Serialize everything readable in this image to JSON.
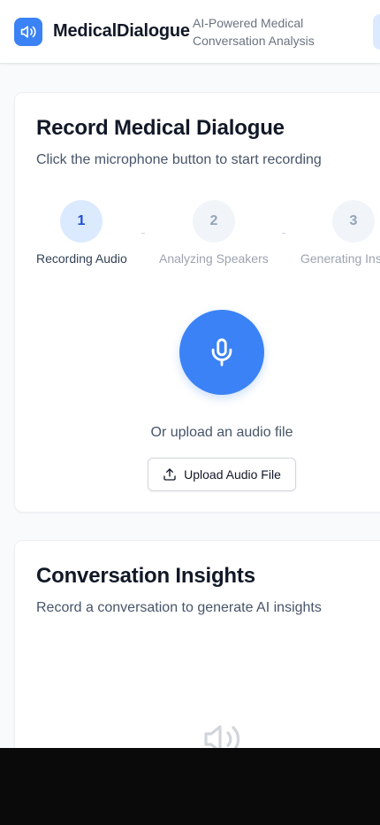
{
  "header": {
    "app_title": "MedicalDialogue",
    "app_subtitle": "AI-Powered Medical Conversation Analysis",
    "logo_icon": "speaker-icon"
  },
  "record_card": {
    "title": "Record Medical Dialogue",
    "description": "Click the microphone button to start recording",
    "steps": [
      {
        "number": "1",
        "label": "Recording Audio",
        "active": true
      },
      {
        "number": "2",
        "label": "Analyzing Speakers",
        "active": false
      },
      {
        "number": "3",
        "label": "Generating Insights",
        "active": false
      }
    ],
    "mic_icon": "microphone-icon",
    "upload_hint": "Or upload an audio file",
    "upload_button_label": "Upload Audio File",
    "upload_icon": "upload-icon"
  },
  "insights_card": {
    "title": "Conversation Insights",
    "description": "Record a conversation to generate AI insights",
    "placeholder_icon": "speaker-icon"
  },
  "colors": {
    "accent": "#3b82f6",
    "accent_light": "#dbeafe",
    "step_active_text": "#1d4ed8"
  }
}
